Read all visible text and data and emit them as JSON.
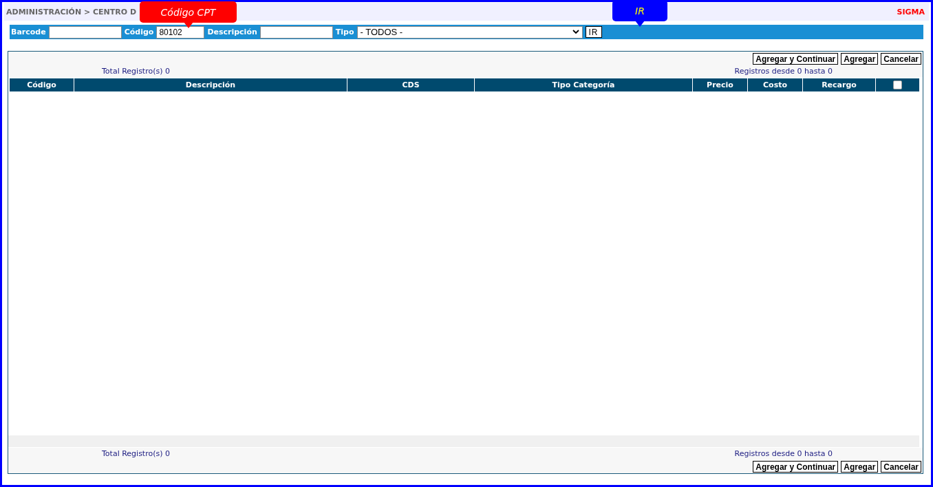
{
  "header": {
    "breadcrumb": "ADMINISTRACIÓN > CENTRO D",
    "brand": "SIGMA"
  },
  "filters": [
    {
      "kind": "text",
      "label": "Barcode"
    },
    {
      "kind": "text",
      "label": "Código",
      "value": "80102"
    },
    {
      "kind": "text",
      "label": "Descripción"
    },
    {
      "kind": "select",
      "label": "Tipo",
      "value": "- TODOS -"
    }
  ],
  "go_button": "IR",
  "callouts": [
    {
      "text": "Código CPT",
      "color": "#ff0000"
    },
    {
      "text": "IR",
      "color": "#0000ff"
    }
  ],
  "top_buttons": [
    "Agregar y Continuar",
    "Agregar",
    "Cancelar"
  ],
  "top_summary": {
    "total": "Total Registro(s) 0",
    "range": "Registros desde 0 hasta 0"
  },
  "table": {
    "columns": [
      "Código",
      "Descripción",
      "CDS",
      "Tipo Categoría",
      "Precio",
      "Costo",
      "Recargo"
    ],
    "select_all": {
      "checked": false
    }
  },
  "bottom_summary": {
    "total": "Total Registro(s) 0",
    "range": "Registros desde 0 hasta 0"
  },
  "bottom_buttons": [
    "Agregar y Continuar",
    "Agregar",
    "Cancelar"
  ]
}
